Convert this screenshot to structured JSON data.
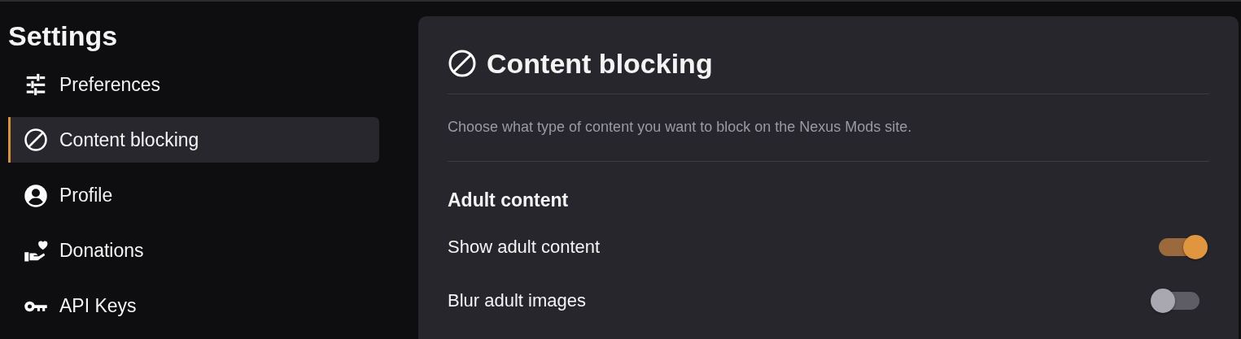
{
  "sidebar": {
    "title": "Settings",
    "items": [
      {
        "label": "Preferences",
        "selected": false
      },
      {
        "label": "Content blocking",
        "selected": true
      },
      {
        "label": "Profile",
        "selected": false
      },
      {
        "label": "Donations",
        "selected": false
      },
      {
        "label": "API Keys",
        "selected": false
      }
    ]
  },
  "panel": {
    "title": "Content blocking",
    "description": "Choose what type of content you want to block on the Nexus Mods site.",
    "section": {
      "title": "Adult content",
      "settings": [
        {
          "label": "Show adult content",
          "on": true
        },
        {
          "label": "Blur adult images",
          "on": false
        }
      ]
    }
  }
}
